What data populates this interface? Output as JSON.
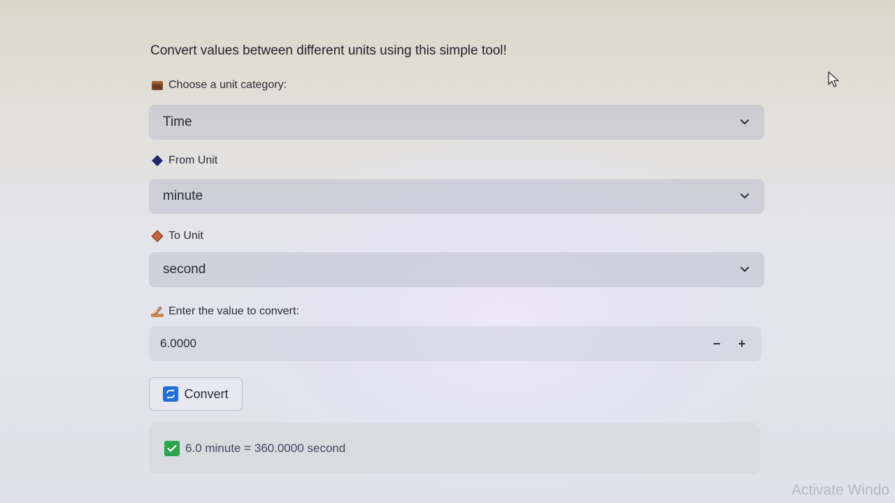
{
  "intro_text": "Convert values between different units using this simple tool!",
  "category": {
    "icon": "package-icon",
    "label": "Choose a unit category:",
    "selected": "Time"
  },
  "from_unit": {
    "icon": "blue-diamond-icon",
    "label": "From Unit",
    "selected": "minute"
  },
  "to_unit": {
    "icon": "orange-diamond-icon",
    "label": "To Unit",
    "selected": "second"
  },
  "value_input": {
    "icon": "writing-hand-icon",
    "label": "Enter the value to convert:",
    "value": "6.0000",
    "decrement_label": "−",
    "increment_label": "+"
  },
  "convert_button": {
    "icon": "repeat-icon",
    "label": "Convert"
  },
  "result": {
    "icon": "check-mark-icon",
    "text": "6.0 minute = 360.0000 second"
  },
  "watermark": "Activate Windo",
  "colors": {
    "accent_blue": "#1e6fd9",
    "success_green": "#2ea44f",
    "diamond_blue": "#1a2a6c",
    "diamond_orange": "#c8603a"
  }
}
